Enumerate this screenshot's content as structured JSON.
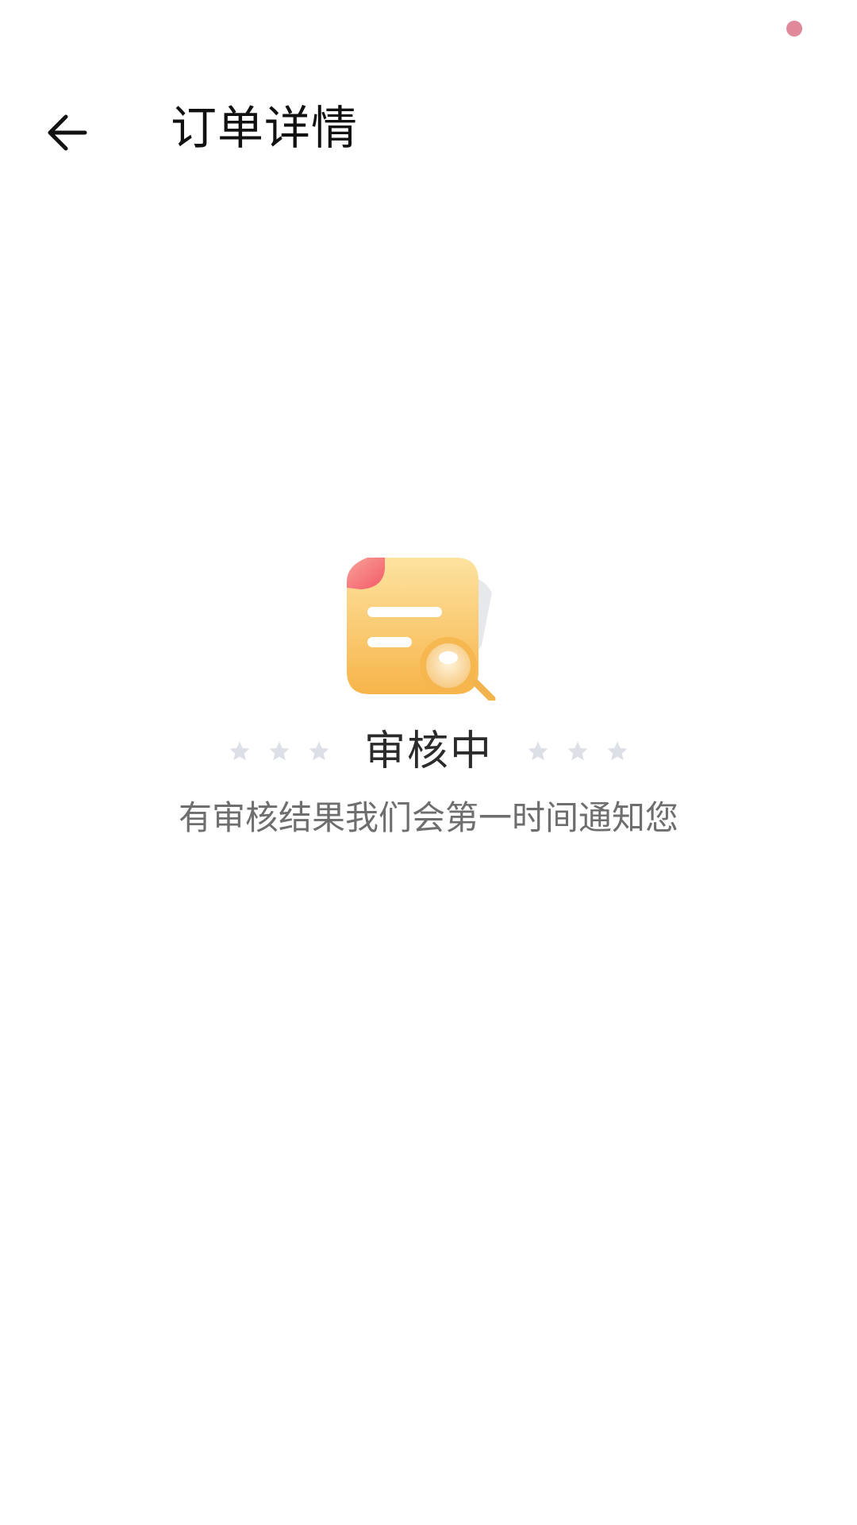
{
  "header": {
    "title": "订单详情",
    "back_icon": "arrow-left-icon"
  },
  "status": {
    "illustration_icon": "document-search-icon",
    "title": "审核中",
    "description": "有审核结果我们会第一时间通知您",
    "decor_icon": "star-icon"
  },
  "colors": {
    "accent_dot": "#e0899b",
    "document_yellow": "#f9c15e",
    "document_corner": "#f5606e",
    "star_gray": "#dde0e6",
    "title_text": "#111111",
    "desc_text": "#6e6e6e"
  }
}
